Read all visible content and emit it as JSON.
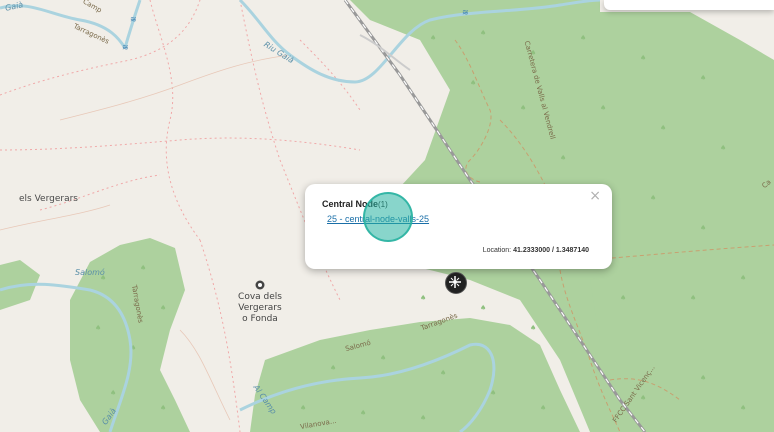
{
  "map": {
    "labels": {
      "vergerars": "els Vergerars",
      "cova": [
        "Cova dels",
        "Vergerars",
        "o Fonda"
      ],
      "riu_gaia_top": "Riu Gaià",
      "gaia_left": "Gaià",
      "gaia_bottom_left": "Gaià",
      "tarragones_top": "Tarragonès",
      "tarragones_left": "Tarragonès",
      "tarragones_mid": "Tarragonès",
      "salomo_left": "Salomó",
      "salomo_bottom": "Salomó",
      "carretera": "Carretera de Valls al Vendrell",
      "ferrocarril": "FFCC Sant Vicenç...",
      "al_camp": "Al Camp",
      "vilanova": "Vilanova...",
      "camp_top": "Camp",
      "top_partial": "Ca"
    },
    "colors": {
      "background": "#f1eee8",
      "forest": "#add19e",
      "water": "#aad3df",
      "rail": "#999999"
    }
  },
  "popup": {
    "title": "Central Node",
    "count": "(1)",
    "link": "25 - central-node-valls-25",
    "location_label": "Location:",
    "location_value": "41.2333000 / 1.3487140",
    "close": "×"
  },
  "marker": {
    "icon": "network-node-icon"
  }
}
